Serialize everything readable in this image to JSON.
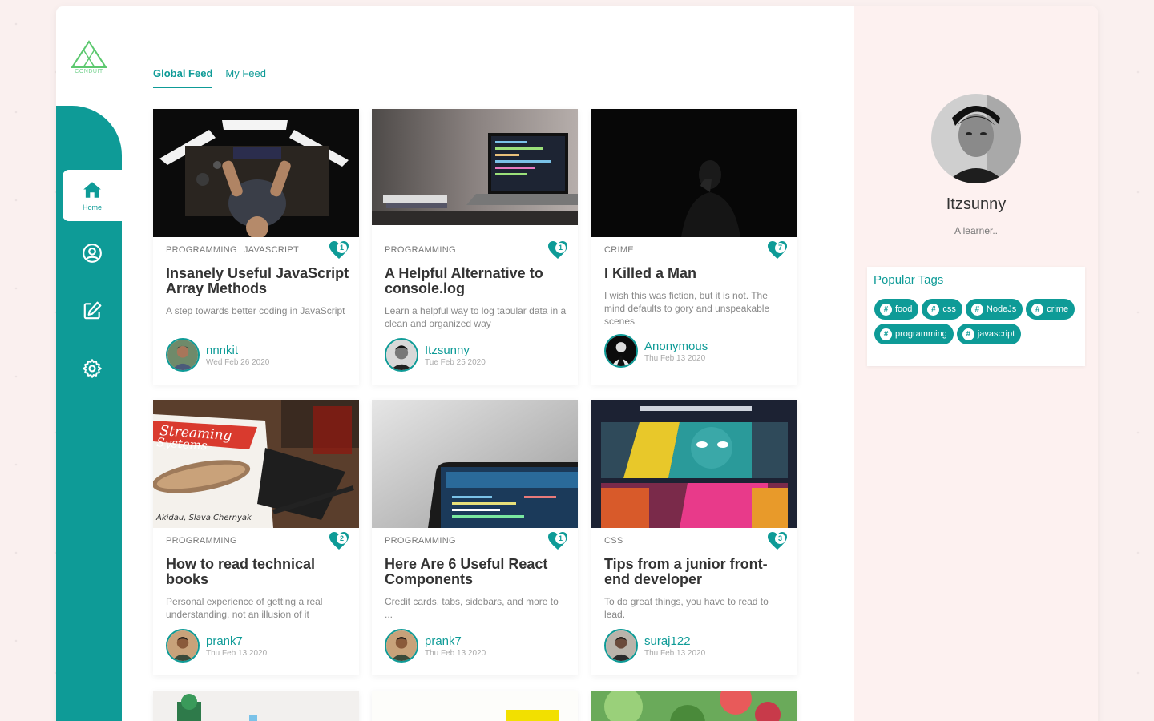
{
  "logo": {
    "text": "CONDUIT"
  },
  "nav": {
    "home_label": "Home"
  },
  "feed_tabs": [
    "Global Feed",
    "My Feed"
  ],
  "articles": [
    {
      "tags": [
        "PROGRAMMING",
        "JAVASCRIPT"
      ],
      "likes": "1",
      "title": "Insanely Useful JavaScript Array Methods",
      "description": "A step towards better coding in JavaScript",
      "author": "nnnkit",
      "date": "Wed Feb 26 2020"
    },
    {
      "tags": [
        "PROGRAMMING"
      ],
      "likes": "1",
      "title": "A Helpful Alternative to console.log",
      "description": "Learn a helpful way to log tabular data in a clean and organized way",
      "author": "Itzsunny",
      "date": "Tue Feb 25 2020"
    },
    {
      "tags": [
        "CRIME"
      ],
      "likes": "7",
      "title": "I Killed a Man",
      "description": "I wish this was fiction, but it is not. The mind defaults to gory and unspeakable scenes",
      "author": "Anonymous",
      "date": "Thu Feb 13 2020"
    },
    {
      "tags": [
        "PROGRAMMING"
      ],
      "likes": "2",
      "title": "How to read technical books",
      "description": "Personal experience of getting a real understanding, not an illusion of it",
      "author": "prank7",
      "date": "Thu Feb 13 2020"
    },
    {
      "tags": [
        "PROGRAMMING"
      ],
      "likes": "1",
      "title": "Here Are 6 Useful React Components",
      "description": "Credit cards, tabs, sidebars, and more to ...",
      "author": "prank7",
      "date": "Thu Feb 13 2020"
    },
    {
      "tags": [
        "CSS"
      ],
      "likes": "3",
      "title": "Tips from a junior front-end developer",
      "description": "To do great things, you have to read to lead.",
      "author": "suraj122",
      "date": "Thu Feb 13 2020"
    }
  ],
  "profile": {
    "name": "Itzsunny",
    "bio": "A learner.."
  },
  "popular_tags": {
    "title": "Popular Tags",
    "items": [
      "food",
      "css",
      "NodeJs",
      "crime",
      "programming",
      "javascript"
    ]
  },
  "colors": {
    "accent": "#0e9b97",
    "panel": "#fdf1f0",
    "page": "#faf0ef"
  }
}
